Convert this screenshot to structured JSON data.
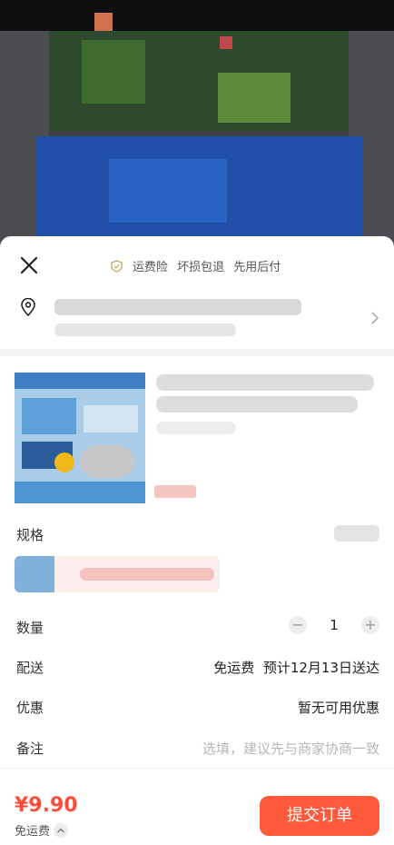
{
  "header": {
    "guarantees": [
      "运费险",
      "坏损包退",
      "先用后付"
    ]
  },
  "spec": {
    "label": "规格"
  },
  "quantity": {
    "label": "数量",
    "value": "1",
    "minus": "−",
    "plus": "+"
  },
  "delivery": {
    "label": "配送",
    "value": "免运费  预计12月13日送达"
  },
  "discount": {
    "label": "优惠",
    "value": "暂无可用优惠"
  },
  "remark": {
    "label": "备注",
    "placeholder": "选填，建议先与商家协商一致"
  },
  "footer": {
    "total": "¥9.90",
    "shipping_note": "免运费",
    "submit": "提交订单"
  },
  "icons": [
    "close-icon",
    "shield-icon",
    "location-pin-icon",
    "chevron-right-icon",
    "chevron-up-icon"
  ],
  "colors": {
    "accent": "#ff5a3c",
    "price": "#ff4c3b",
    "shield": "#c9a26a"
  }
}
